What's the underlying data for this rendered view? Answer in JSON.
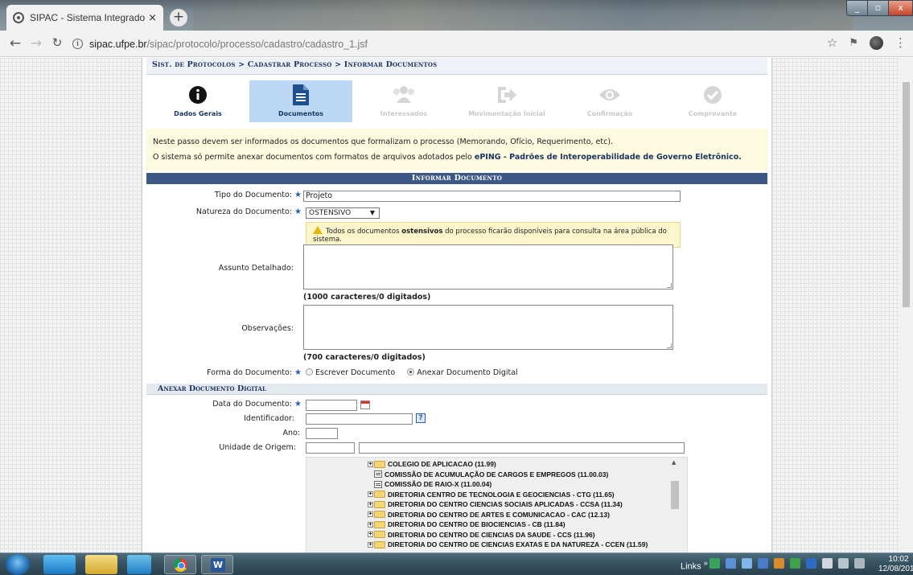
{
  "browser": {
    "tab_title": "SIPAC - Sistema Integrado de Pat",
    "tab_close": "×",
    "new_tab": "+",
    "url_host": "sipac.ufpe.br",
    "url_path": "/sipac/protocolo/processo/cadastro/cadastro_1.jsf"
  },
  "breadcrumb": "Sist. de Protocolos > Cadastrar Processo > Informar Documentos",
  "steps": [
    {
      "label": "Dados Gerais",
      "icon": "info-icon",
      "state": "done"
    },
    {
      "label": "Documentos",
      "icon": "document-icon",
      "state": "active"
    },
    {
      "label": "Interessados",
      "icon": "users-icon",
      "state": "disabled"
    },
    {
      "label": "Movimentação Inicial",
      "icon": "move-icon",
      "state": "disabled"
    },
    {
      "label": "Confirmação",
      "icon": "eye-icon",
      "state": "disabled"
    },
    {
      "label": "Comprovante",
      "icon": "check-icon",
      "state": "disabled"
    }
  ],
  "notice": {
    "line1": "Neste passo devem ser informados os documentos que formalizam o processo (Memorando, Ofício, Requerimento, etc).",
    "line2_prefix": "O sistema só permite anexar documentos com formatos de arquivos adotados pelo ",
    "line2_link": "ePING - Padrões de Interoperabilidade de Governo Eletrônico."
  },
  "section_title": "Informar Documento",
  "form": {
    "tipo_label": "Tipo do Documento:",
    "tipo_value": "Projeto",
    "natureza_label": "Natureza do Documento:",
    "natureza_value": "OSTENSIVO",
    "natureza_arrow": "▼",
    "warning_prefix": "Todos os documentos ",
    "warning_bold": "ostensivos",
    "warning_suffix": " do processo ficarão disponíveis para consulta na área pública do sistema.",
    "assunto_label": "Assunto Detalhado:",
    "assunto_counter": "(1000 caracteres/0 digitados)",
    "obs_label": "Observações:",
    "obs_counter": "(700 caracteres/0 digitados)",
    "forma_label": "Forma do Documento:",
    "forma_option1": "Escrever Documento",
    "forma_option2": "Anexar Documento Digital",
    "required_star": "★"
  },
  "attach": {
    "section_title": "Anexar Documento Digital",
    "data_label": "Data do Documento:",
    "ident_label": "Identificador:",
    "help_glyph": "?",
    "ano_label": "Ano:",
    "unidade_label": "Unidade de Origem:"
  },
  "tree": [
    {
      "type": "folder",
      "label": "COLEGIO DE APLICACAO (11.99)"
    },
    {
      "type": "unit",
      "label": "COMISSÃO DE ACUMULAÇÃO DE CARGOS E EMPREGOS (11.00.03)"
    },
    {
      "type": "unit",
      "label": "COMISSÃO DE RAIO-X (11.00.04)"
    },
    {
      "type": "folder",
      "label": "DIRETORIA CENTRO DE TECNOLOGIA E GEOCIENCIAS - CTG (11.65)"
    },
    {
      "type": "folder",
      "label": "DIRETORIA DO CENTRO CIENCIAS SOCIAIS APLICADAS - CCSA (11.34)"
    },
    {
      "type": "folder",
      "label": "DIRETORIA DO CENTRO DE ARTES E COMUNICACAO - CAC (12.13)"
    },
    {
      "type": "folder",
      "label": "DIRETORIA DO CENTRO DE BIOCIENCIAS - CB (11.84)"
    },
    {
      "type": "folder",
      "label": "DIRETORIA DO CENTRO DE CIENCIAS DA SAUDE - CCS (11.96)"
    },
    {
      "type": "folder",
      "label": "DIRETORIA DO CENTRO DE CIENCIAS EXATAS E DA NATUREZA - CCEN (11.59)"
    }
  ],
  "taskbar": {
    "links": "Links",
    "chevron": "»",
    "time": "10:02",
    "date": "12/08/2019"
  },
  "colors": {
    "accent": "#1c3561",
    "section_bar": "#3d5787",
    "active_step": "#bcd8f4",
    "notice_bg": "#fdfae0"
  }
}
